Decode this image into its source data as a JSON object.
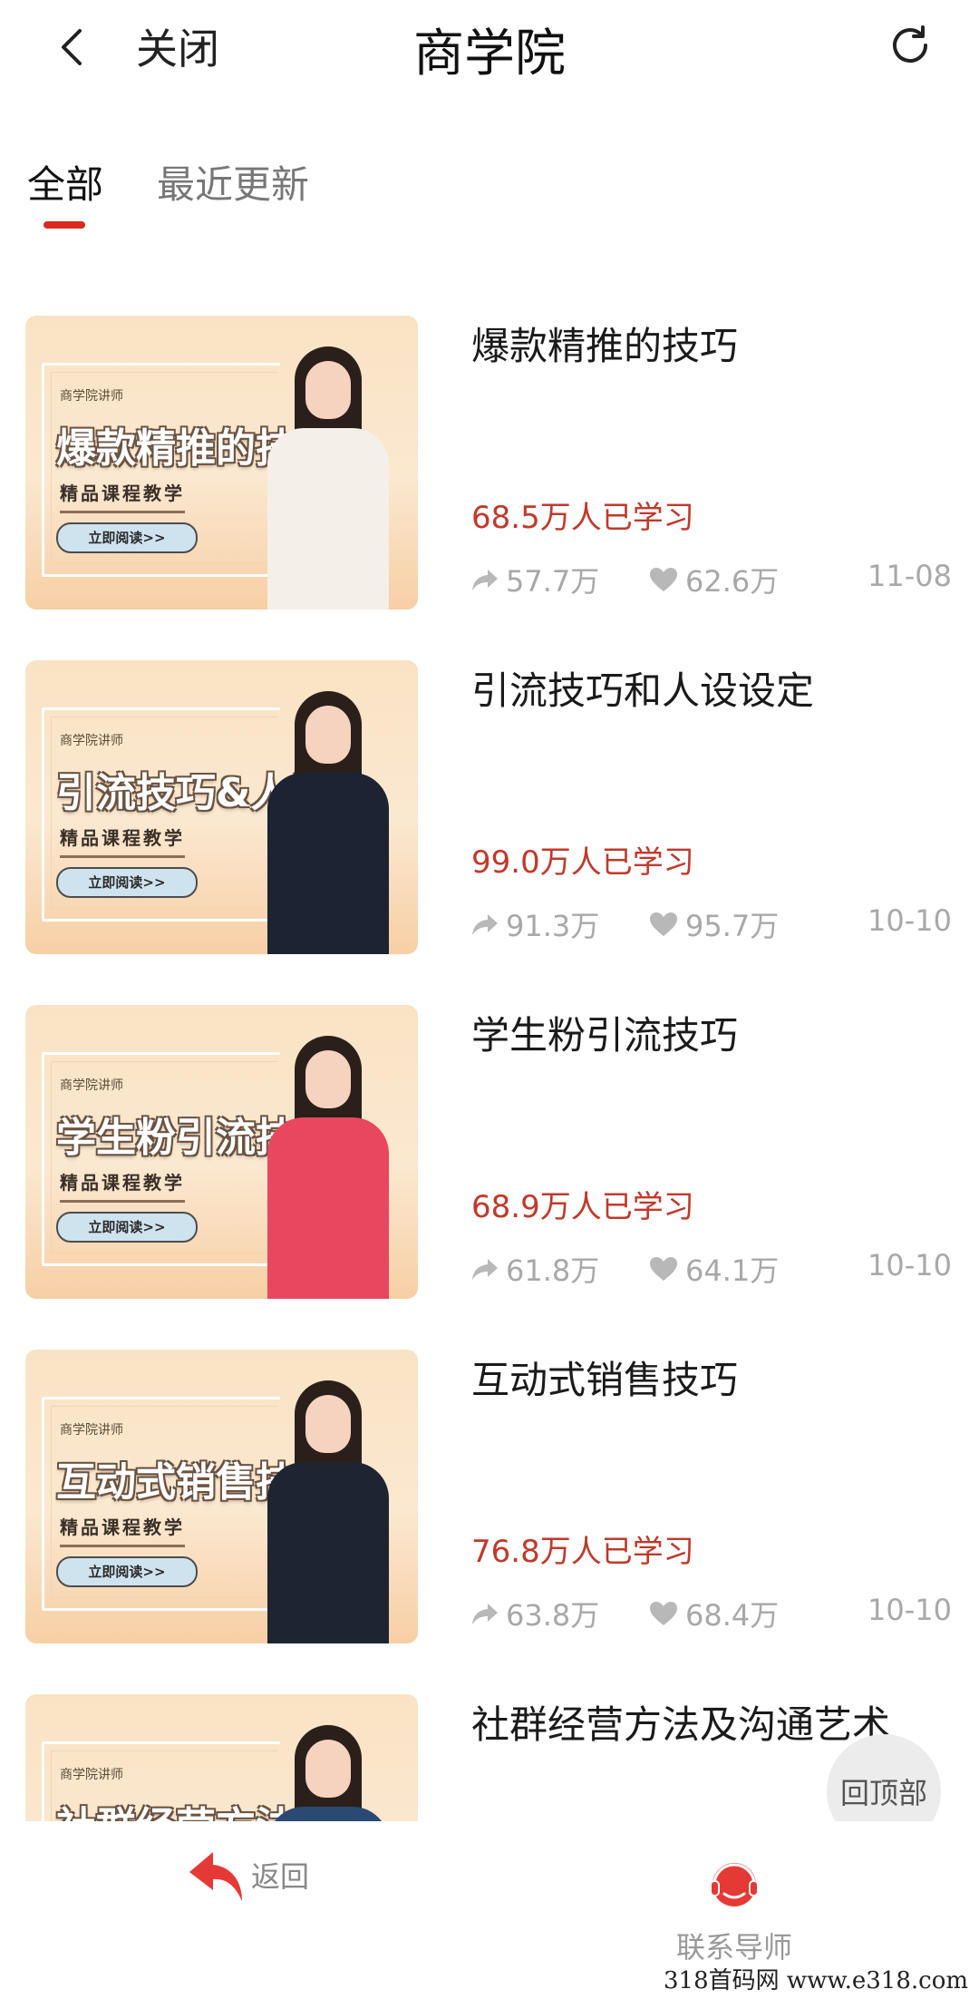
{
  "header": {
    "close_label": "关闭",
    "title": "商学院"
  },
  "tabs": [
    {
      "label": "全部",
      "active": true
    },
    {
      "label": "最近更新",
      "active": false
    }
  ],
  "thumb_common": {
    "tag": "商学院讲师",
    "subtitle": "精品课程教学",
    "button": "立即阅读>>"
  },
  "courses": [
    {
      "thumb_title": "爆款精推的技巧",
      "title": "爆款精推的技巧",
      "learners": "68.5万人已学习",
      "shares": "57.7万",
      "likes": "62.6万",
      "date": "11-08",
      "outfit": "#f4efe8"
    },
    {
      "thumb_title": "引流技巧&人设",
      "title": "引流技巧和人设设定",
      "learners": "99.0万人已学习",
      "shares": "91.3万",
      "likes": "95.7万",
      "date": "10-10",
      "outfit": "#1c2333"
    },
    {
      "thumb_title": "学生粉引流技巧",
      "title": "学生粉引流技巧",
      "learners": "68.9万人已学习",
      "shares": "61.8万",
      "likes": "64.1万",
      "date": "10-10",
      "outfit": "#e8475f"
    },
    {
      "thumb_title": "互动式销售技巧",
      "title": "互动式销售技巧",
      "learners": "76.8万人已学习",
      "shares": "63.8万",
      "likes": "68.4万",
      "date": "10-10",
      "outfit": "#1f2433"
    },
    {
      "thumb_title": "社群经营方法",
      "title": "社群经营方法及沟通艺术",
      "learners": "",
      "shares": "",
      "likes": "",
      "date": "",
      "outfit": "#2a4a73"
    }
  ],
  "back_to_top": "回顶部",
  "bottom_nav": {
    "back_label": "返回",
    "contact_label": "联系导师"
  },
  "watermark": "318首码网  www.e318.com",
  "colors": {
    "accent": "#d9281f",
    "learners": "#c0392b",
    "muted": "#a8a8a8"
  }
}
